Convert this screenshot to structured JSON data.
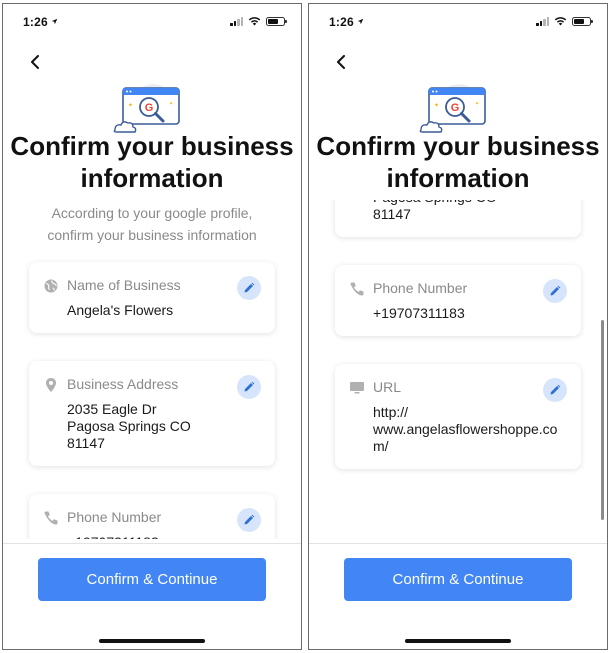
{
  "status_bar": {
    "time": "1:26"
  },
  "title_line1": "Confirm your business",
  "title_line2": "information",
  "subtitle_line1": "According to your google profile,",
  "subtitle_line2": "confirm your business information",
  "fields": {
    "name": {
      "label": "Name of Business",
      "value": "Angela's Flowers",
      "icon": "globe-icon"
    },
    "address": {
      "label": "Business Address",
      "value": "2035 Eagle Dr\nPagosa Springs CO\n81147",
      "icon": "location-pin-icon"
    },
    "phone": {
      "label": "Phone Number",
      "value": "+19707311183",
      "icon": "phone-icon"
    },
    "url": {
      "label": "URL",
      "value": "http://\nwww.angelasflowershoppe.com/",
      "icon": "monitor-icon"
    }
  },
  "confirm_label": "Confirm & Continue",
  "colors": {
    "accent": "#4285f4",
    "edit_bg": "#d6e5fb",
    "muted_text": "#8a8a8a"
  }
}
